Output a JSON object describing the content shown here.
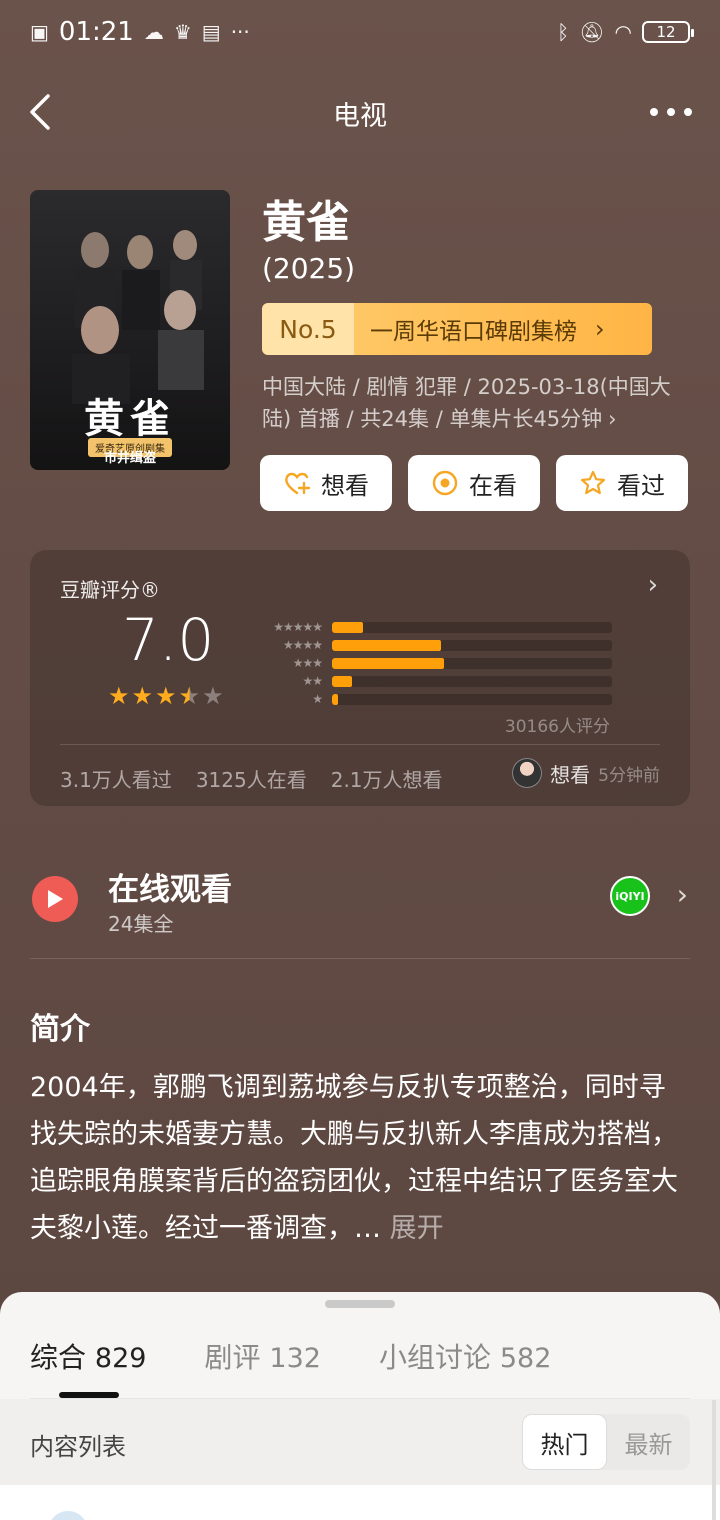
{
  "status_bar": {
    "time": "01:21",
    "battery": "12"
  },
  "nav": {
    "title": "电视"
  },
  "show": {
    "title": "黄雀",
    "year": "(2025)",
    "rank_no": "No.5",
    "rank_label": "一周华语口碑剧集榜",
    "meta": "中国大陆 / 剧情 犯罪 / 2025-03-18(中国大陆) 首播 / 共24集 / 单集片长45分钟",
    "poster_title": "黄雀",
    "poster_sub": "爱奇艺原创剧集",
    "poster_foot": "市井缉盗"
  },
  "actions": [
    {
      "label": "想看",
      "icon": "heart-plus-icon"
    },
    {
      "label": "在看",
      "icon": "watching-circle-icon"
    },
    {
      "label": "看过",
      "icon": "star-outline-icon"
    }
  ],
  "rating": {
    "title": "豆瓣评分®",
    "score": "7.0",
    "stars_value": 3.5,
    "distribution": [
      {
        "stars": "★★★★★",
        "fraction": 0.11
      },
      {
        "stars": "★★★★",
        "fraction": 0.39
      },
      {
        "stars": "★★★",
        "fraction": 0.4
      },
      {
        "stars": "★★",
        "fraction": 0.07
      },
      {
        "stars": "★",
        "fraction": 0.02
      }
    ],
    "count": "30166人评分",
    "stats": [
      "3.1万人看过",
      "3125人在看",
      "2.1万人想看"
    ],
    "recent_action": "想看",
    "recent_time": "5分钟前"
  },
  "watch": {
    "title": "在线观看",
    "subtitle": "24集全",
    "provider": "iQIYI"
  },
  "synopsis": {
    "title": "简介",
    "text": "2004年，郭鹏飞调到荔城参与反扒专项整治，同时寻找失踪的未婚妻方慧。大鹏与反扒新人李唐成为搭档，追踪眼角膜案背后的盗窃团伙，过程中结识了医务室大夫黎小莲。经过一番调查，…",
    "expand": "展开"
  },
  "sheet": {
    "tabs": [
      {
        "label": "综合",
        "count": "829"
      },
      {
        "label": "剧评",
        "count": "132"
      },
      {
        "label": "小组讨论",
        "count": "582"
      }
    ],
    "list_label": "内容列表",
    "sort": [
      "热门",
      "最新"
    ]
  },
  "colors": {
    "accent": "#ff9f0a",
    "play": "#ef5b55",
    "iqiyi": "#18c21b",
    "rank": "#ffb545"
  }
}
